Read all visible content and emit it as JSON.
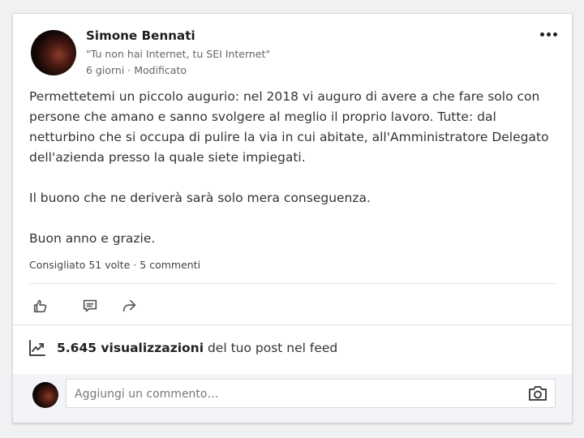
{
  "post": {
    "author_name": "Simone Bennati",
    "author_headline": "\"Tu non hai Internet, tu SEI Internet\"",
    "meta": "6 giorni · Modificato",
    "paragraphs": [
      "Permettetemi un piccolo augurio: nel 2018 vi auguro di avere a che fare solo con persone che amano e sanno svolgere al meglio il proprio lavoro. Tutte: dal netturbino che si occupa di pulire la via in cui abitate, all'Amministratore Delegato dell'azienda presso la quale siete impiegati.",
      "Il buono che ne deriverà sarà solo mera conseguenza.",
      "Buon anno e grazie."
    ]
  },
  "social": {
    "recommended": "Consigliato 51 volte",
    "separator": " · ",
    "comments": "5 commenti"
  },
  "actions": {
    "like_icon": "thumbs-up-icon",
    "comment_icon": "comment-icon",
    "share_icon": "share-icon"
  },
  "views": {
    "count": "5.645 visualizzazioni",
    "suffix": " del tuo post nel feed",
    "icon": "trending-up-icon"
  },
  "comment": {
    "placeholder": "Aggiungi un commento…",
    "camera_icon": "camera-icon"
  },
  "colors": {
    "background": "#f0f1f3",
    "card": "#ffffff",
    "comment_area": "#f2f4f7",
    "text": "#333333",
    "muted": "#666666"
  }
}
